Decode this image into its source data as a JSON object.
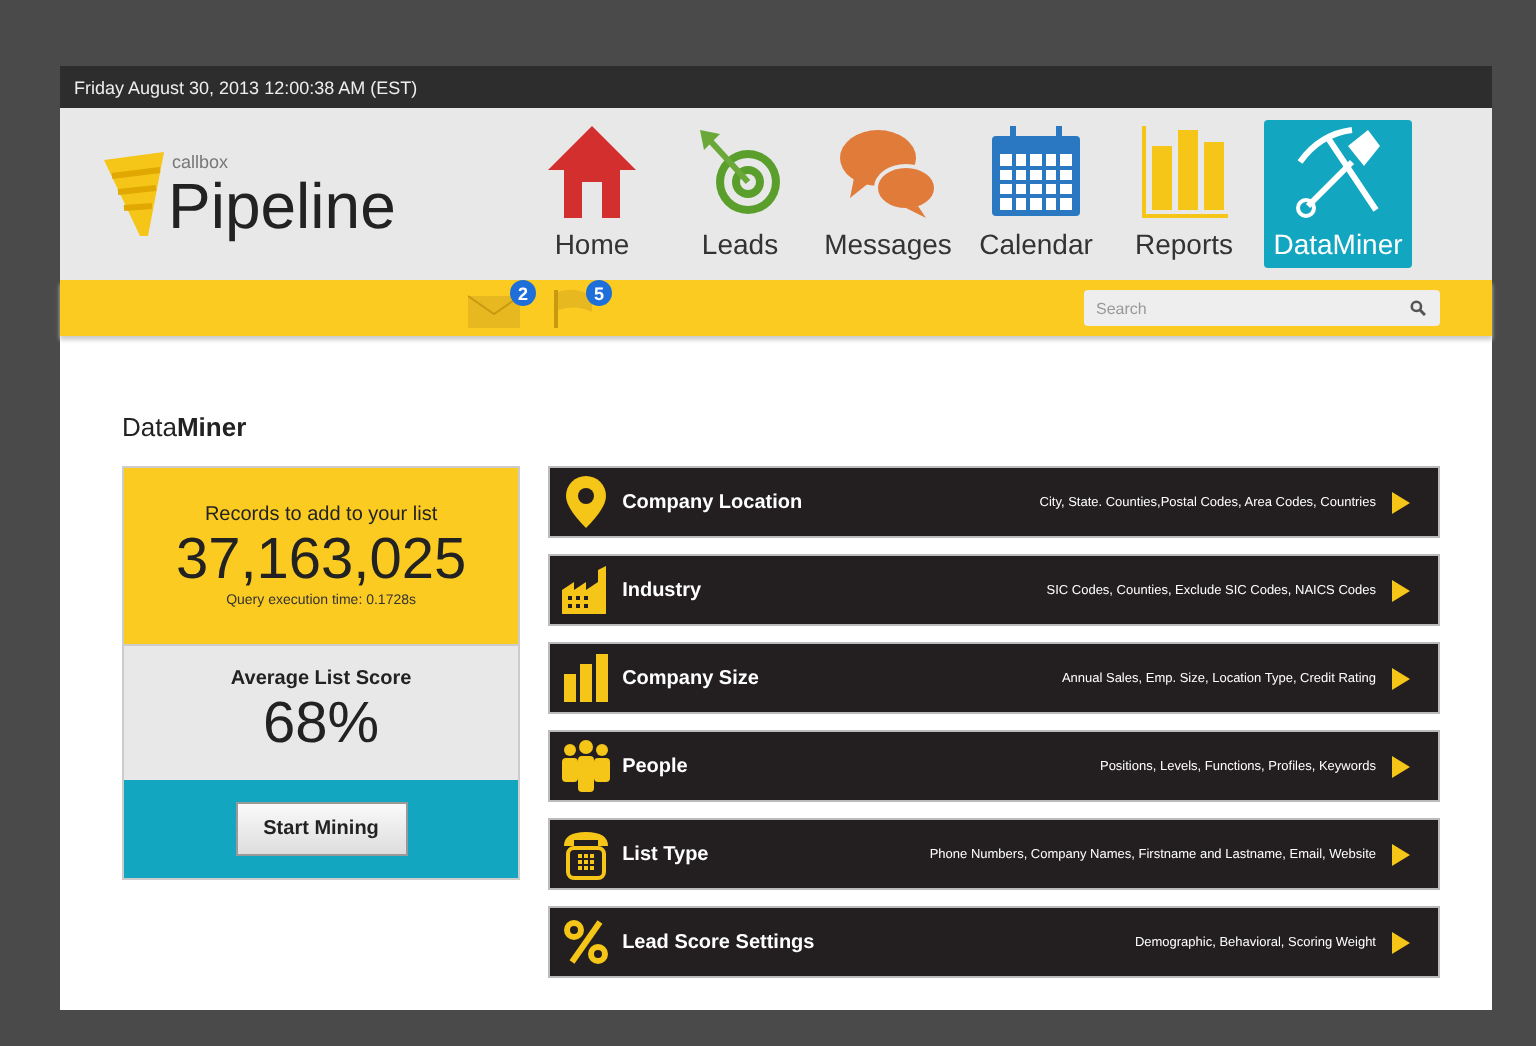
{
  "top_bar": {
    "datetime": "Friday August 30, 2013 12:00:38 AM (EST)"
  },
  "logo": {
    "brand": "callbox",
    "product": "Pipeline"
  },
  "nav": [
    {
      "label": "Home",
      "kind": "home",
      "selected": false
    },
    {
      "label": "Leads",
      "kind": "target",
      "selected": false
    },
    {
      "label": "Messages",
      "kind": "chat",
      "selected": false
    },
    {
      "label": "Calendar",
      "kind": "calendar",
      "selected": false
    },
    {
      "label": "Reports",
      "kind": "chart",
      "selected": false
    },
    {
      "label": "DataMiner",
      "kind": "mining",
      "selected": true
    }
  ],
  "notifications": [
    {
      "kind": "mail",
      "count": "2"
    },
    {
      "kind": "flag",
      "count": "5"
    }
  ],
  "search": {
    "placeholder": "Search"
  },
  "page_title": "Data**Miner**",
  "summary": {
    "records_label": "Records to add to your list",
    "records": "37,163,025",
    "query_time": "Query execution time:  0.1728s",
    "score_label": "Average List Score",
    "score": "68%",
    "button": "Start Mining"
  },
  "categories": [
    {
      "kind": "location",
      "title": "Company Location",
      "details": "City, State. Counties,Postal Codes, Area Codes, Countries"
    },
    {
      "kind": "industry",
      "title": "Industry",
      "details": "SIC Codes, Counties, Exclude SIC Codes, NAICS Codes"
    },
    {
      "kind": "size",
      "title": "Company Size",
      "details": "Annual Sales, Emp. Size, Location Type, Credit Rating"
    },
    {
      "kind": "people",
      "title": "People",
      "details": "Positions, Levels, Functions, Profiles, Keywords"
    },
    {
      "kind": "phone",
      "title": "List Type",
      "details": "Phone Numbers, Company Names, Firstname and Lastname, Email, Website"
    },
    {
      "kind": "percent",
      "title": "Lead Score Settings",
      "details": "Demographic, Behavioral, Scoring Weight"
    }
  ]
}
